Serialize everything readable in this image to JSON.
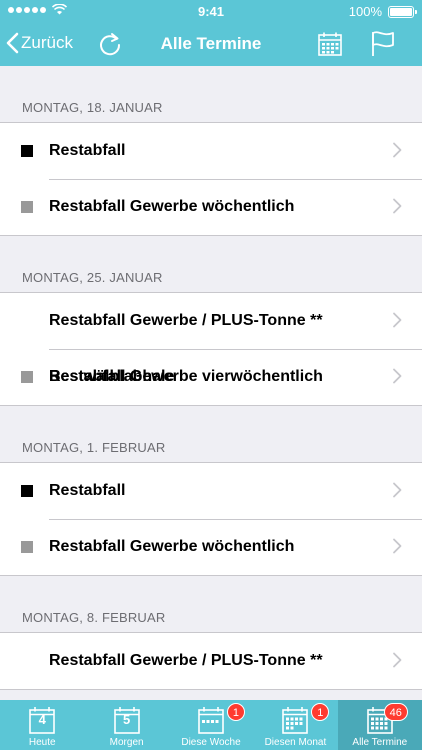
{
  "status_bar": {
    "time": "9:41",
    "battery": "100%",
    "signal_icon": "signal-dots-icon",
    "wifi_icon": "wifi-icon"
  },
  "nav": {
    "back_label": "Zurück",
    "title": "Alle Termine",
    "back_icon": "chevron-left-icon",
    "refresh_icon": "refresh-icon",
    "calendar_icon": "calendar-grid-icon",
    "flag_icon": "flag-icon"
  },
  "sections": [
    {
      "header": "MONTAG, 18. JANUAR",
      "items": [
        {
          "label": "Restabfall",
          "color": "#000000"
        },
        {
          "label": "Restabfall Gewerbe wöchentlich",
          "color": "#999999"
        }
      ]
    },
    {
      "header": "MONTAG, 25. JANUAR",
      "items": [
        {
          "label": "Restabfall Gewerbe / PLUS-Tonne **",
          "color": ""
        },
        {
          "label": "Restabfall Gewerbe vierwöchentlich",
          "color": "#999999",
          "overlap": "Bestwälblabhale"
        }
      ]
    },
    {
      "header": "MONTAG, 1. FEBRUAR",
      "items": [
        {
          "label": "Restabfall",
          "color": "#000000"
        },
        {
          "label": "Restabfall Gewerbe wöchentlich",
          "color": "#999999"
        }
      ]
    },
    {
      "header": "MONTAG, 8. FEBRUAR",
      "items": [
        {
          "label": "Restabfall Gewerbe / PLUS-Tonne **",
          "color": ""
        }
      ]
    }
  ],
  "tabs": [
    {
      "label": "Heute",
      "day": "4",
      "badge": ""
    },
    {
      "label": "Morgen",
      "day": "5",
      "badge": ""
    },
    {
      "label": "Diese Woche",
      "day": "",
      "badge": "1"
    },
    {
      "label": "Diesen Monat",
      "day": "",
      "badge": "1"
    },
    {
      "label": "Alle Termine",
      "day": "",
      "badge": "46"
    }
  ],
  "colors": {
    "accent": "#5bc6d6",
    "active_tab": "#4aa9b8",
    "badge": "#ff3b30"
  }
}
